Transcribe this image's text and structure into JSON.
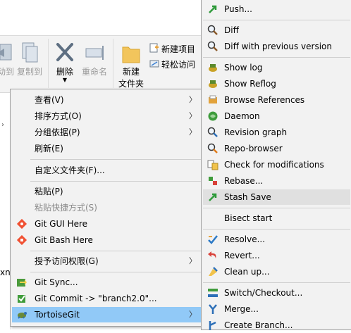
{
  "ribbon": {
    "copy_to": "复制到",
    "move_to_partial": "动到",
    "delete": "删除",
    "rename": "重命名",
    "new_folder_line1": "新建",
    "new_folder_line2": "文件夹",
    "new_item": "新建项目",
    "easy_access": "轻松访问"
  },
  "background_fragment": "xn",
  "context_menu": {
    "items": [
      {
        "label": "查看(V)",
        "has_submenu": true
      },
      {
        "label": "排序方式(O)",
        "has_submenu": true
      },
      {
        "label": "分组依据(P)",
        "has_submenu": true
      },
      {
        "label": "刷新(E)",
        "has_submenu": false
      },
      {
        "label": "自定义文件夹(F)...",
        "has_submenu": false
      },
      {
        "label": "粘贴(P)",
        "has_submenu": false
      },
      {
        "label": "粘贴快捷方式(S)",
        "has_submenu": false,
        "disabled": true
      },
      {
        "label": "Git GUI Here",
        "icon": "git-gui-icon"
      },
      {
        "label": "Git Bash Here",
        "icon": "git-bash-icon"
      },
      {
        "label": "授予访问权限(G)",
        "has_submenu": true
      },
      {
        "label": "Git Sync...",
        "icon": "git-sync-icon"
      },
      {
        "label": "Git Commit -> \"branch2.0\"...",
        "icon": "git-commit-icon"
      },
      {
        "label": "TortoiseGit",
        "icon": "tortoisegit-icon",
        "has_submenu": true,
        "highlighted": true
      }
    ]
  },
  "submenu": {
    "items": [
      {
        "label": "Push...",
        "icon": "push-icon"
      },
      {
        "label": "Diff",
        "icon": "diff-icon"
      },
      {
        "label": "Diff with previous version",
        "icon": "diff-prev-icon"
      },
      {
        "label": "Show log",
        "icon": "show-log-icon"
      },
      {
        "label": "Show Reflog",
        "icon": "show-reflog-icon"
      },
      {
        "label": "Browse References",
        "icon": "browse-references-icon"
      },
      {
        "label": "Daemon",
        "icon": "daemon-icon"
      },
      {
        "label": "Revision graph",
        "icon": "revision-graph-icon"
      },
      {
        "label": "Repo-browser",
        "icon": "repo-browser-icon"
      },
      {
        "label": "Check for modifications",
        "icon": "check-modifications-icon"
      },
      {
        "label": "Rebase...",
        "icon": "rebase-icon"
      },
      {
        "label": "Stash Save",
        "icon": "stash-save-icon"
      },
      {
        "label": "Bisect start",
        "icon": ""
      },
      {
        "label": "Resolve...",
        "icon": "resolve-icon"
      },
      {
        "label": "Revert...",
        "icon": "revert-icon"
      },
      {
        "label": "Clean up...",
        "icon": "clean-up-icon"
      },
      {
        "label": "Switch/Checkout...",
        "icon": "switch-checkout-icon"
      },
      {
        "label": "Merge...",
        "icon": "merge-icon"
      },
      {
        "label": "Create Branch...",
        "icon": "create-branch-icon"
      }
    ]
  }
}
